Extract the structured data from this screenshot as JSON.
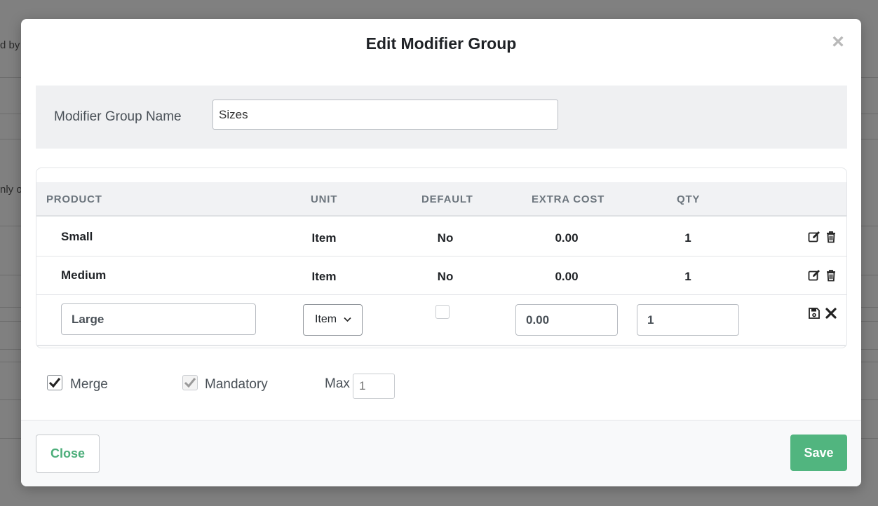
{
  "background": {
    "fragments": [
      "d by",
      "nly o"
    ]
  },
  "modal": {
    "title": "Edit Modifier Group",
    "close_icon": "close-icon",
    "name_label": "Modifier Group Name",
    "name_value": "Sizes"
  },
  "table": {
    "headers": {
      "product": "PRODUCT",
      "unit": "UNIT",
      "default": "DEFAULT",
      "extra_cost": "EXTRA COST",
      "qty": "QTY"
    },
    "rows": [
      {
        "product": "Small",
        "unit": "Item",
        "default": "No",
        "extra_cost": "0.00",
        "qty": "1"
      },
      {
        "product": "Medium",
        "unit": "Item",
        "default": "No",
        "extra_cost": "0.00",
        "qty": "1"
      }
    ],
    "edit_row": {
      "product": "Large",
      "unit": "Item",
      "default_checked": false,
      "extra_cost": "0.00",
      "qty": "1"
    }
  },
  "options": {
    "merge_label": "Merge",
    "merge_checked": true,
    "mandatory_label": "Mandatory",
    "mandatory_checked": true,
    "max_label": "Max",
    "max_placeholder": "1"
  },
  "footer": {
    "close_label": "Close",
    "save_label": "Save"
  },
  "colors": {
    "accent": "#51b57f",
    "overlay": "#808080"
  }
}
